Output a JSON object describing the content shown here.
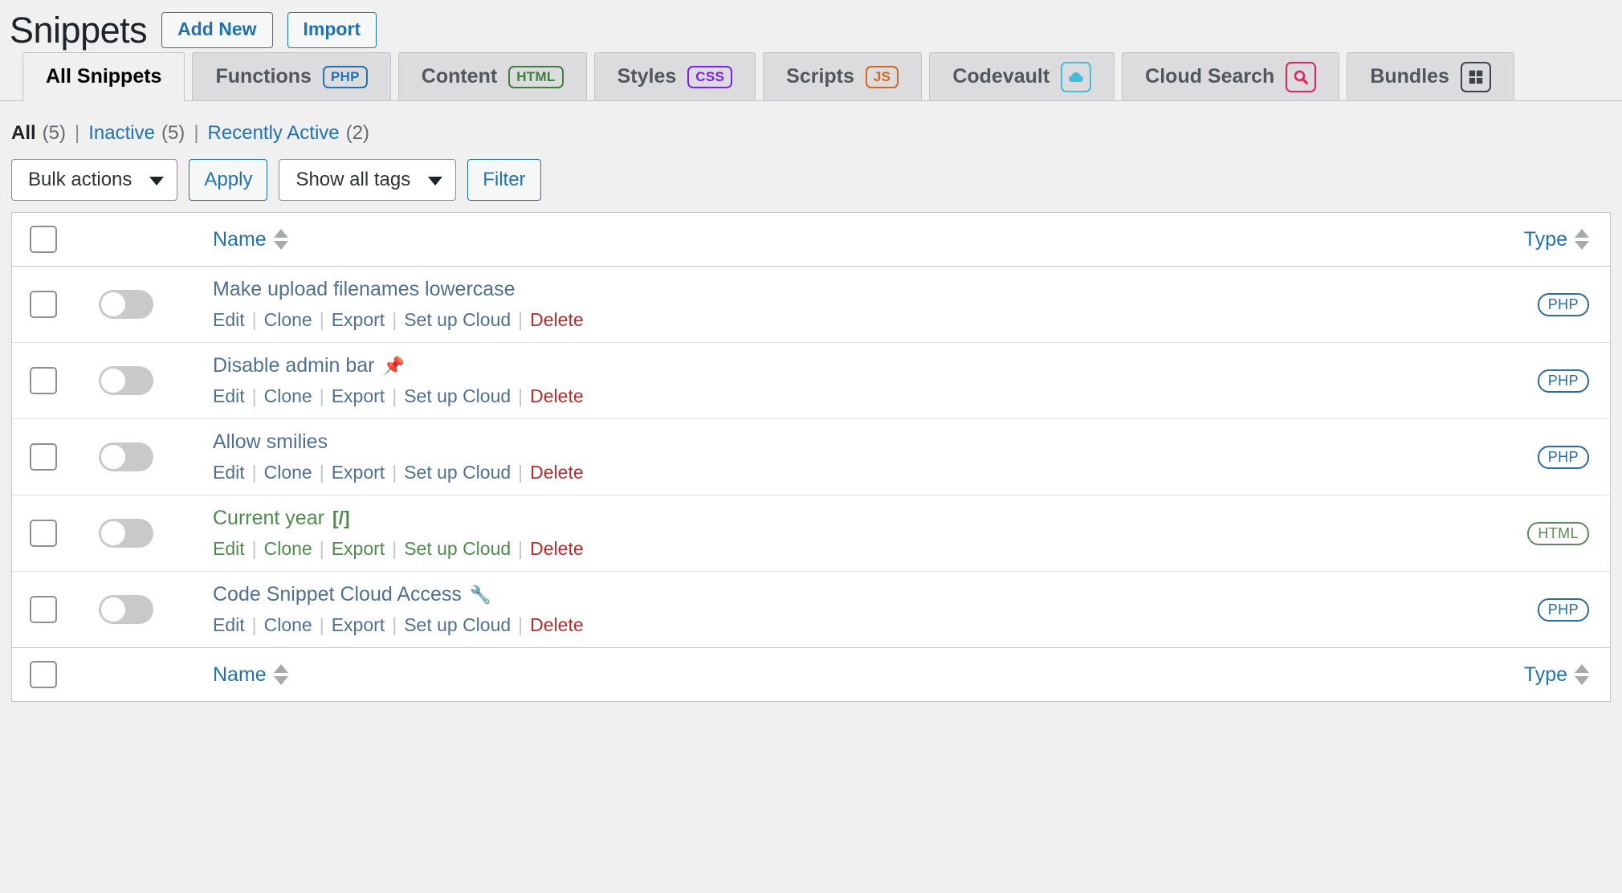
{
  "header": {
    "title": "Snippets",
    "actions": [
      {
        "label": "Add New",
        "name": "add-new-button"
      },
      {
        "label": "Import",
        "name": "import-button"
      }
    ]
  },
  "tabs": [
    {
      "label": "All Snippets",
      "badge": null,
      "badge_type": null,
      "active": true
    },
    {
      "label": "Functions",
      "badge": "PHP",
      "badge_type": "text",
      "badge_color": "#2271b1",
      "active": false
    },
    {
      "label": "Content",
      "badge": "HTML",
      "badge_type": "text",
      "badge_color": "#3f7e3f",
      "active": false
    },
    {
      "label": "Styles",
      "badge": "CSS",
      "badge_type": "text",
      "badge_color": "#7c1ff5",
      "active": false
    },
    {
      "label": "Scripts",
      "badge": "JS",
      "badge_type": "text",
      "badge_color": "#d2691e",
      "active": false
    },
    {
      "label": "Codevault",
      "badge": "cloud-icon",
      "badge_type": "icon",
      "badge_color": "#45bcd8",
      "active": false
    },
    {
      "label": "Cloud Search",
      "badge": "search-icon",
      "badge_type": "icon",
      "badge_color": "#e0245e",
      "active": false
    },
    {
      "label": "Bundles",
      "badge": "grid-icon",
      "badge_type": "icon",
      "badge_color": "#3c434a",
      "active": false
    }
  ],
  "filter_links": [
    {
      "label": "All",
      "count": "(5)",
      "current": true
    },
    {
      "label": "Inactive",
      "count": "(5)",
      "current": false
    },
    {
      "label": "Recently Active",
      "count": "(2)",
      "current": false
    }
  ],
  "tablenav": {
    "bulk_actions_label": "Bulk actions",
    "apply_label": "Apply",
    "tags_label": "Show all tags",
    "filter_label": "Filter"
  },
  "table": {
    "columns": {
      "name": "Name",
      "type": "Type"
    },
    "rows": [
      {
        "name": "Make upload filenames lowercase",
        "name_icon": "",
        "color": "blue",
        "enabled": false,
        "type": "PHP",
        "actions": [
          "Edit",
          "Clone",
          "Export",
          "Set up Cloud",
          "Delete"
        ]
      },
      {
        "name": "Disable admin bar",
        "name_icon": "📌",
        "color": "blue",
        "enabled": false,
        "type": "PHP",
        "actions": [
          "Edit",
          "Clone",
          "Export",
          "Set up Cloud",
          "Delete"
        ]
      },
      {
        "name": "Allow smilies",
        "name_icon": "",
        "color": "blue",
        "enabled": false,
        "type": "PHP",
        "actions": [
          "Edit",
          "Clone",
          "Export",
          "Set up Cloud",
          "Delete"
        ]
      },
      {
        "name": "Current year",
        "name_icon": "[/]",
        "color": "green",
        "enabled": false,
        "type": "HTML",
        "actions": [
          "Edit",
          "Clone",
          "Export",
          "Set up Cloud",
          "Delete"
        ]
      },
      {
        "name": "Code Snippet Cloud Access",
        "name_icon": "🔧",
        "color": "blue",
        "enabled": false,
        "type": "PHP",
        "actions": [
          "Edit",
          "Clone",
          "Export",
          "Set up Cloud",
          "Delete"
        ]
      }
    ]
  },
  "colors": {
    "link": "#2271b1",
    "delete": "#b32d2e",
    "page_bg": "#f0f0f1",
    "row_name": "#50708f",
    "row_name_green": "#4f8a4f"
  }
}
